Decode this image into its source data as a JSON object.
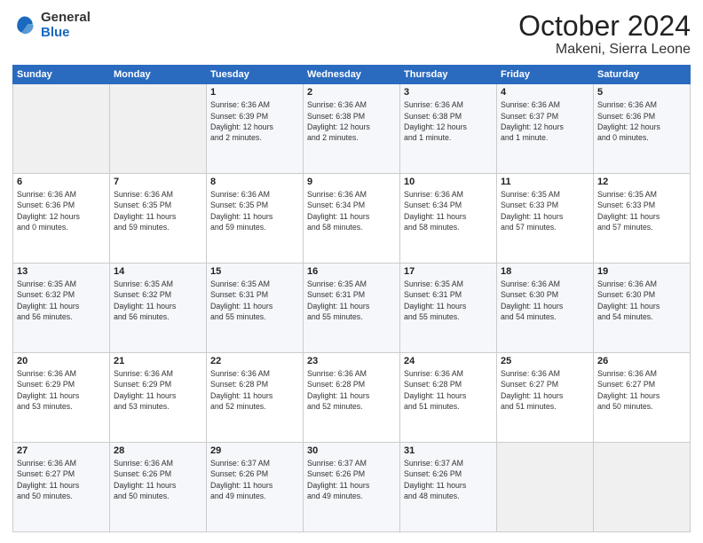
{
  "logo": {
    "general": "General",
    "blue": "Blue"
  },
  "title": "October 2024",
  "location": "Makeni, Sierra Leone",
  "days_of_week": [
    "Sunday",
    "Monday",
    "Tuesday",
    "Wednesday",
    "Thursday",
    "Friday",
    "Saturday"
  ],
  "weeks": [
    [
      {
        "day": "",
        "info": ""
      },
      {
        "day": "",
        "info": ""
      },
      {
        "day": "1",
        "info": "Sunrise: 6:36 AM\nSunset: 6:39 PM\nDaylight: 12 hours\nand 2 minutes."
      },
      {
        "day": "2",
        "info": "Sunrise: 6:36 AM\nSunset: 6:38 PM\nDaylight: 12 hours\nand 2 minutes."
      },
      {
        "day": "3",
        "info": "Sunrise: 6:36 AM\nSunset: 6:38 PM\nDaylight: 12 hours\nand 1 minute."
      },
      {
        "day": "4",
        "info": "Sunrise: 6:36 AM\nSunset: 6:37 PM\nDaylight: 12 hours\nand 1 minute."
      },
      {
        "day": "5",
        "info": "Sunrise: 6:36 AM\nSunset: 6:36 PM\nDaylight: 12 hours\nand 0 minutes."
      }
    ],
    [
      {
        "day": "6",
        "info": "Sunrise: 6:36 AM\nSunset: 6:36 PM\nDaylight: 12 hours\nand 0 minutes."
      },
      {
        "day": "7",
        "info": "Sunrise: 6:36 AM\nSunset: 6:35 PM\nDaylight: 11 hours\nand 59 minutes."
      },
      {
        "day": "8",
        "info": "Sunrise: 6:36 AM\nSunset: 6:35 PM\nDaylight: 11 hours\nand 59 minutes."
      },
      {
        "day": "9",
        "info": "Sunrise: 6:36 AM\nSunset: 6:34 PM\nDaylight: 11 hours\nand 58 minutes."
      },
      {
        "day": "10",
        "info": "Sunrise: 6:36 AM\nSunset: 6:34 PM\nDaylight: 11 hours\nand 58 minutes."
      },
      {
        "day": "11",
        "info": "Sunrise: 6:35 AM\nSunset: 6:33 PM\nDaylight: 11 hours\nand 57 minutes."
      },
      {
        "day": "12",
        "info": "Sunrise: 6:35 AM\nSunset: 6:33 PM\nDaylight: 11 hours\nand 57 minutes."
      }
    ],
    [
      {
        "day": "13",
        "info": "Sunrise: 6:35 AM\nSunset: 6:32 PM\nDaylight: 11 hours\nand 56 minutes."
      },
      {
        "day": "14",
        "info": "Sunrise: 6:35 AM\nSunset: 6:32 PM\nDaylight: 11 hours\nand 56 minutes."
      },
      {
        "day": "15",
        "info": "Sunrise: 6:35 AM\nSunset: 6:31 PM\nDaylight: 11 hours\nand 55 minutes."
      },
      {
        "day": "16",
        "info": "Sunrise: 6:35 AM\nSunset: 6:31 PM\nDaylight: 11 hours\nand 55 minutes."
      },
      {
        "day": "17",
        "info": "Sunrise: 6:35 AM\nSunset: 6:31 PM\nDaylight: 11 hours\nand 55 minutes."
      },
      {
        "day": "18",
        "info": "Sunrise: 6:36 AM\nSunset: 6:30 PM\nDaylight: 11 hours\nand 54 minutes."
      },
      {
        "day": "19",
        "info": "Sunrise: 6:36 AM\nSunset: 6:30 PM\nDaylight: 11 hours\nand 54 minutes."
      }
    ],
    [
      {
        "day": "20",
        "info": "Sunrise: 6:36 AM\nSunset: 6:29 PM\nDaylight: 11 hours\nand 53 minutes."
      },
      {
        "day": "21",
        "info": "Sunrise: 6:36 AM\nSunset: 6:29 PM\nDaylight: 11 hours\nand 53 minutes."
      },
      {
        "day": "22",
        "info": "Sunrise: 6:36 AM\nSunset: 6:28 PM\nDaylight: 11 hours\nand 52 minutes."
      },
      {
        "day": "23",
        "info": "Sunrise: 6:36 AM\nSunset: 6:28 PM\nDaylight: 11 hours\nand 52 minutes."
      },
      {
        "day": "24",
        "info": "Sunrise: 6:36 AM\nSunset: 6:28 PM\nDaylight: 11 hours\nand 51 minutes."
      },
      {
        "day": "25",
        "info": "Sunrise: 6:36 AM\nSunset: 6:27 PM\nDaylight: 11 hours\nand 51 minutes."
      },
      {
        "day": "26",
        "info": "Sunrise: 6:36 AM\nSunset: 6:27 PM\nDaylight: 11 hours\nand 50 minutes."
      }
    ],
    [
      {
        "day": "27",
        "info": "Sunrise: 6:36 AM\nSunset: 6:27 PM\nDaylight: 11 hours\nand 50 minutes."
      },
      {
        "day": "28",
        "info": "Sunrise: 6:36 AM\nSunset: 6:26 PM\nDaylight: 11 hours\nand 50 minutes."
      },
      {
        "day": "29",
        "info": "Sunrise: 6:37 AM\nSunset: 6:26 PM\nDaylight: 11 hours\nand 49 minutes."
      },
      {
        "day": "30",
        "info": "Sunrise: 6:37 AM\nSunset: 6:26 PM\nDaylight: 11 hours\nand 49 minutes."
      },
      {
        "day": "31",
        "info": "Sunrise: 6:37 AM\nSunset: 6:26 PM\nDaylight: 11 hours\nand 48 minutes."
      },
      {
        "day": "",
        "info": ""
      },
      {
        "day": "",
        "info": ""
      }
    ]
  ]
}
